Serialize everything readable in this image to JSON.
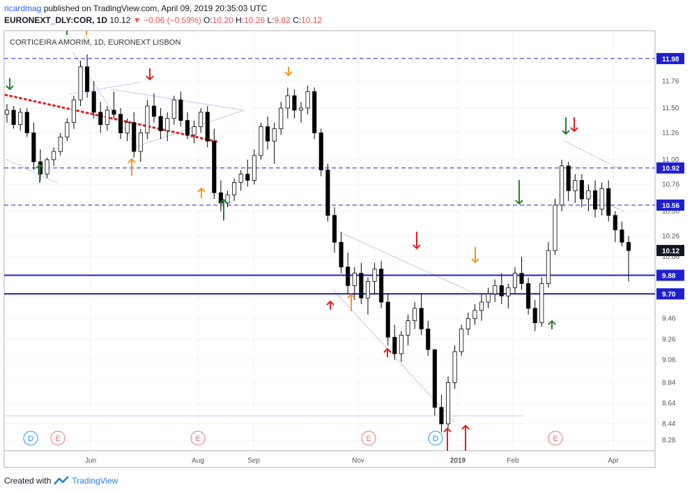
{
  "header": {
    "user": "ricardmag",
    "published": "published on TradingView.com, April 09, 2019 20:35:03 UTC",
    "symbol": "EURONEXT_DLY:COR, 1D",
    "last": "10.12",
    "change": "▼ −0.06 (−0.59%)",
    "o_label": "O:",
    "o_value": "10.20",
    "h_label": "H:",
    "h_value": "10.26",
    "l_label": "L:",
    "l_value": "9.82",
    "c_label": "C:",
    "c_value": "10.12"
  },
  "chart_title": "CORTICEIRA AMORIM, 1D, EURONEXT LISBON",
  "footer": {
    "created": "Created with",
    "brand": "TradingView"
  },
  "colors": {
    "up_candle": "#ffffff",
    "down_candle": "#000000",
    "blue_line": "#1f1fd0",
    "tag_bg": "#131722",
    "tag_blue": "#1f1fd0",
    "red_dots": "#e41b1b",
    "arrow_green": "#2e7d32",
    "arrow_red": "#e31b1b",
    "arrow_orange": "#f7931e"
  },
  "chart_data": {
    "type": "candlestick",
    "title": "CORTICEIRA AMORIM, 1D, EURONEXT LISBON",
    "y_ticks": [
      11.76,
      11.5,
      11.26,
      11.0,
      10.76,
      10.5,
      10.26,
      10.06,
      9.68,
      9.46,
      9.26,
      9.06,
      8.84,
      8.64,
      8.44,
      8.28
    ],
    "x_ticks": [
      "Jun",
      "Aug",
      "Sep",
      "Nov",
      "2019",
      "Feb",
      "Apr"
    ],
    "ylim": [
      8.18,
      12.25
    ],
    "horizontal_levels": [
      {
        "value": 11.98,
        "label": "11.98",
        "style": "dashed"
      },
      {
        "value": 10.92,
        "label": "10.92",
        "style": "dashed"
      },
      {
        "value": 10.56,
        "label": "10.56",
        "style": "dashed"
      },
      {
        "value": 9.88,
        "label": "9.88",
        "style": "solid"
      },
      {
        "value": 9.7,
        "label": "9.70",
        "style": "solid"
      }
    ],
    "last_price": {
      "value": 10.12,
      "label": "10.12"
    },
    "event_markers": [
      "D",
      "E",
      "E",
      "E",
      "D",
      "E"
    ],
    "ohlc": [
      [
        11.44,
        11.54,
        11.36,
        11.48
      ],
      [
        11.48,
        11.52,
        11.3,
        11.34
      ],
      [
        11.34,
        11.5,
        11.28,
        11.46
      ],
      [
        11.46,
        11.5,
        11.22,
        11.26
      ],
      [
        11.26,
        11.36,
        10.9,
        10.98
      ],
      [
        10.98,
        11.1,
        10.8,
        10.86
      ],
      [
        10.86,
        11.02,
        10.82,
        11.0
      ],
      [
        11.0,
        11.12,
        10.94,
        11.08
      ],
      [
        11.08,
        11.26,
        11.04,
        11.22
      ],
      [
        11.22,
        11.4,
        11.18,
        11.36
      ],
      [
        11.36,
        11.62,
        11.3,
        11.58
      ],
      [
        11.58,
        11.96,
        11.52,
        11.9
      ],
      [
        11.9,
        12.02,
        11.6,
        11.66
      ],
      [
        11.66,
        11.76,
        11.4,
        11.46
      ],
      [
        11.46,
        11.56,
        11.26,
        11.34
      ],
      [
        11.34,
        11.52,
        11.28,
        11.48
      ],
      [
        11.48,
        11.66,
        11.4,
        11.44
      ],
      [
        11.44,
        11.5,
        11.2,
        11.26
      ],
      [
        11.26,
        11.4,
        11.18,
        11.36
      ],
      [
        11.36,
        11.46,
        11.02,
        11.08
      ],
      [
        11.08,
        11.3,
        10.98,
        11.26
      ],
      [
        11.26,
        11.58,
        11.2,
        11.52
      ],
      [
        11.52,
        11.64,
        11.36,
        11.42
      ],
      [
        11.42,
        11.5,
        11.2,
        11.28
      ],
      [
        11.28,
        11.46,
        11.18,
        11.4
      ],
      [
        11.4,
        11.62,
        11.34,
        11.58
      ],
      [
        11.58,
        11.66,
        11.32,
        11.38
      ],
      [
        11.38,
        11.46,
        11.2,
        11.24
      ],
      [
        11.24,
        11.38,
        11.16,
        11.32
      ],
      [
        11.32,
        11.5,
        11.26,
        11.46
      ],
      [
        11.46,
        11.52,
        11.12,
        11.18
      ],
      [
        11.18,
        11.3,
        10.62,
        10.68
      ],
      [
        10.68,
        10.8,
        10.5,
        10.58
      ],
      [
        10.58,
        10.7,
        10.54,
        10.66
      ],
      [
        10.66,
        10.82,
        10.6,
        10.78
      ],
      [
        10.78,
        10.9,
        10.7,
        10.86
      ],
      [
        10.86,
        11.0,
        10.74,
        10.8
      ],
      [
        10.8,
        11.1,
        10.76,
        11.04
      ],
      [
        11.04,
        11.36,
        11.0,
        11.32
      ],
      [
        11.32,
        11.42,
        11.1,
        11.18
      ],
      [
        11.18,
        11.36,
        10.96,
        11.3
      ],
      [
        11.3,
        11.56,
        11.24,
        11.5
      ],
      [
        11.5,
        11.7,
        11.4,
        11.62
      ],
      [
        11.62,
        11.68,
        11.4,
        11.48
      ],
      [
        11.48,
        11.56,
        11.36,
        11.5
      ],
      [
        11.5,
        11.72,
        11.44,
        11.66
      ],
      [
        11.66,
        11.7,
        11.2,
        11.26
      ],
      [
        11.26,
        11.3,
        10.84,
        10.9
      ],
      [
        10.9,
        10.96,
        10.4,
        10.46
      ],
      [
        10.46,
        10.54,
        10.1,
        10.2
      ],
      [
        10.2,
        10.3,
        9.9,
        9.96
      ],
      [
        9.96,
        10.1,
        9.7,
        9.78
      ],
      [
        9.78,
        9.96,
        9.64,
        9.9
      ],
      [
        9.9,
        10.0,
        9.6,
        9.66
      ],
      [
        9.66,
        9.86,
        9.5,
        9.82
      ],
      [
        9.82,
        10.0,
        9.7,
        9.94
      ],
      [
        9.94,
        10.02,
        9.56,
        9.62
      ],
      [
        9.62,
        9.7,
        9.2,
        9.28
      ],
      [
        9.28,
        9.4,
        9.06,
        9.12
      ],
      [
        9.12,
        9.34,
        9.04,
        9.3
      ],
      [
        9.3,
        9.5,
        9.2,
        9.44
      ],
      [
        9.44,
        9.62,
        9.36,
        9.56
      ],
      [
        9.56,
        9.7,
        9.3,
        9.36
      ],
      [
        9.36,
        9.44,
        9.1,
        9.16
      ],
      [
        9.16,
        9.02,
        8.52,
        8.6
      ],
      [
        8.6,
        8.72,
        8.36,
        8.44
      ],
      [
        8.44,
        8.9,
        8.4,
        8.84
      ],
      [
        8.84,
        9.2,
        8.78,
        9.14
      ],
      [
        9.14,
        9.4,
        9.1,
        9.36
      ],
      [
        9.36,
        9.52,
        9.3,
        9.46
      ],
      [
        9.46,
        9.6,
        9.4,
        9.54
      ],
      [
        9.54,
        9.7,
        9.44,
        9.62
      ],
      [
        9.62,
        9.76,
        9.56,
        9.7
      ],
      [
        9.7,
        9.84,
        9.62,
        9.78
      ],
      [
        9.78,
        9.9,
        9.6,
        9.68
      ],
      [
        9.68,
        9.8,
        9.56,
        9.76
      ],
      [
        9.76,
        9.96,
        9.7,
        9.9
      ],
      [
        9.9,
        10.06,
        9.74,
        9.8
      ],
      [
        9.8,
        9.86,
        9.5,
        9.56
      ],
      [
        9.56,
        9.64,
        9.34,
        9.42
      ],
      [
        9.42,
        9.86,
        9.38,
        9.8
      ],
      [
        9.8,
        10.2,
        9.76,
        10.12
      ],
      [
        10.12,
        10.62,
        10.08,
        10.56
      ],
      [
        10.56,
        11.0,
        10.5,
        10.94
      ],
      [
        10.94,
        10.98,
        10.6,
        10.7
      ],
      [
        10.7,
        10.86,
        10.58,
        10.8
      ],
      [
        10.8,
        10.86,
        10.54,
        10.62
      ],
      [
        10.62,
        10.76,
        10.5,
        10.7
      ],
      [
        10.7,
        10.8,
        10.44,
        10.52
      ],
      [
        10.52,
        10.78,
        10.46,
        10.72
      ],
      [
        10.72,
        10.8,
        10.4,
        10.46
      ],
      [
        10.46,
        10.5,
        10.2,
        10.32
      ],
      [
        10.32,
        10.4,
        10.16,
        10.2
      ],
      [
        10.2,
        10.26,
        9.82,
        10.12
      ]
    ]
  }
}
